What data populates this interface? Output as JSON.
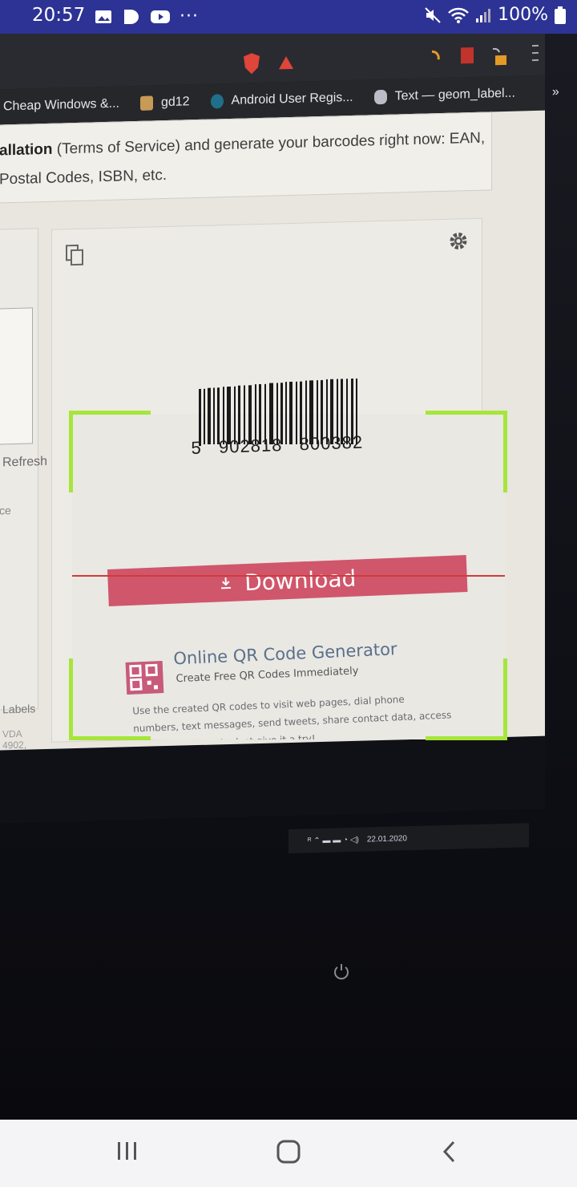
{
  "status_bar": {
    "time": "20:57",
    "left_icons": [
      "image-icon",
      "play-icon",
      "youtube-icon",
      "more-dots-icon"
    ],
    "battery": "100%"
  },
  "camera_feed": {
    "browser": {
      "bookmarks": [
        {
          "label": "Cheap Windows &...",
          "icon": "bookmark-icon"
        },
        {
          "label": "gd12",
          "icon": "folder-icon"
        },
        {
          "label": "Android User Regis...",
          "icon": "site-icon"
        },
        {
          "label": "Text — geom_label...",
          "icon": "r-icon"
        }
      ]
    },
    "page": {
      "intro_bold": "allation",
      "intro_rest": " (Terms of Service) and generate your barcodes right now: EAN,",
      "intro_line2": "Postal Codes, ISBN, etc.",
      "refresh": "Refresh",
      "side_label_ce": "ce",
      "side_label_labels": "Labels",
      "side_label_vdb": "VDA 4902,",
      "barcode_digits": "5   902818   800382",
      "download_label": "Download",
      "qr_title": "Online QR Code Generator",
      "qr_subtitle": "Create Free QR Codes Immediately",
      "qr_desc": "Use the created QR codes to visit web pages, dial phone numbers, text messages, send tweets, share contact data, access social networks, etc. Just give it a try!",
      "taskbar_date": "22.01.2020"
    }
  },
  "scanner": {
    "frame_color": "#a6e63a",
    "scan_line_color": "#d33a3a"
  },
  "nav_bar": {
    "buttons": [
      "recents-icon",
      "home-icon",
      "back-icon"
    ]
  }
}
